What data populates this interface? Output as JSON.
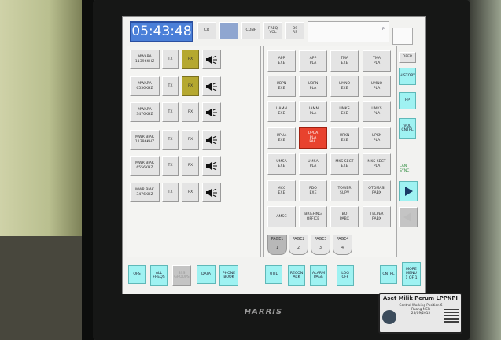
{
  "top_bar": {
    "clock": "05:43:48",
    "buttons": [
      "CR",
      "",
      "CONF",
      "FREQ\nVOL",
      "OS\nRS"
    ],
    "indicator": "P"
  },
  "radio_rows": [
    {
      "name": "MWARA\n11396KHZ",
      "tx": "TX",
      "rx": "RX",
      "rx_active": true
    },
    {
      "name": "MWARA\n6556KHZ",
      "tx": "TX",
      "rx": "RX",
      "rx_active": true
    },
    {
      "name": "MWARA\n3476KHZ",
      "tx": "TX",
      "rx": "RX",
      "rx_active": false
    },
    {
      "name": "MWR BIAK\n11396KHZ",
      "tx": "TX",
      "rx": "RX",
      "rx_active": false
    },
    {
      "name": "MWR BIAK\n6556KHZ",
      "tx": "TX",
      "rx": "RX",
      "rx_active": false
    },
    {
      "name": "MWR BIAK\n3476KHZ",
      "tx": "TX",
      "rx": "RX",
      "rx_active": false
    }
  ],
  "phone_grid": [
    [
      "APP\nEXE",
      "APP\nPLA",
      "TMA\nEXE",
      "TMA\nPLA"
    ],
    [
      "UBPN\nEXE",
      "UBPN\nPLA",
      "UMNO\nEXE",
      "UMNO\nPLA"
    ],
    [
      "UAMN\nEXE",
      "UAMN\nPLA",
      "UMKS\nEXE",
      "UMKS\nPLA"
    ],
    [
      "UPUA\nEXE",
      "UPUA\nPLA\nFAIL",
      "UPKN\nEXE",
      "UPKN\nPLA"
    ],
    [
      "UMSA\nEXE",
      "UMSA\nPLA",
      "MKS SECT\nEXE",
      "MKS SECT\nPLA"
    ],
    [
      "MCC\nEXE",
      "FDO\nEXE",
      "TOWER\nSUPV",
      "OTOMASI\nPABX"
    ],
    [
      "AMSC",
      "BRIEFING\nOFFICE",
      "BO\nPABX",
      "TELPER\nPABX"
    ]
  ],
  "pages": [
    {
      "label": "PAGE1",
      "num": "1"
    },
    {
      "label": "PAGE2",
      "num": "2"
    },
    {
      "label": "PAGE3",
      "num": "3"
    },
    {
      "label": "PAGE4",
      "num": "4"
    }
  ],
  "right_column": {
    "oper": "OPER",
    "history": "HISTORY",
    "rp": "RP",
    "vol_cntl": "VOL\nCNTRL",
    "legend_line1": "LAN",
    "legend_line2": "SYNC"
  },
  "bottom_bar": {
    "ops": "OPS",
    "all_freqs": "ALL\nFREQS",
    "disabled": "SSS\nGROUPS",
    "data": "DATA",
    "phone_book": "PHONE\nBOOK",
    "util": "UTIL",
    "recon_ack": "RECON\nACK",
    "alarm_page": "ALARM\nPAGE",
    "log_off": "LOG\nOFF",
    "cntrl": "CNTRL",
    "more_menu": "MORE\nMENU\n1 OF 1"
  },
  "brand": "HARRIS",
  "sticker": {
    "title": "Aset Milik Perum LPPNPI",
    "line2": "Control Working Position 6",
    "line3": "Ruang MER",
    "line4": "25/09/2015"
  }
}
